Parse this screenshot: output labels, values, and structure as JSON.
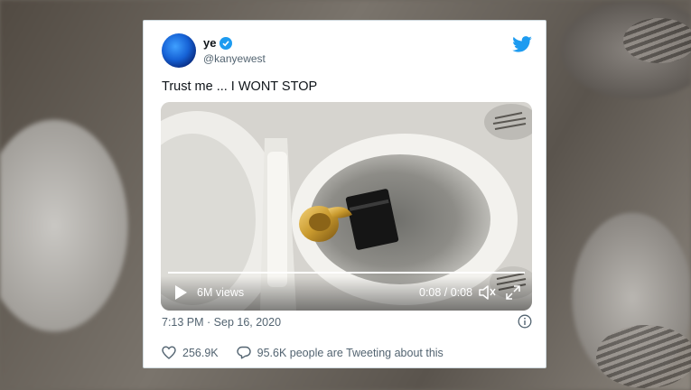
{
  "tweet": {
    "display_name": "ye",
    "handle": "@kanyewest",
    "text": "Trust me ... I WONT STOP",
    "timestamp": "7:13 PM · Sep 16, 2020",
    "likes": "256.9K",
    "tweeting_about": "95.6K people are Tweeting about this",
    "verified": true
  },
  "video": {
    "views": "6M views",
    "timecode": "0:08 / 0:08",
    "progress": 1.0
  },
  "colors": {
    "brand_blue": "#1d9bf0",
    "text_primary": "#0f1419",
    "text_secondary": "#536471"
  },
  "icons": {
    "twitter": "twitter-bird-icon",
    "verified": "verified-badge-icon",
    "play": "play-icon",
    "volume": "volume-icon",
    "expand": "expand-icon",
    "info": "info-icon",
    "like": "heart-icon",
    "reply": "speech-bubble-icon"
  }
}
